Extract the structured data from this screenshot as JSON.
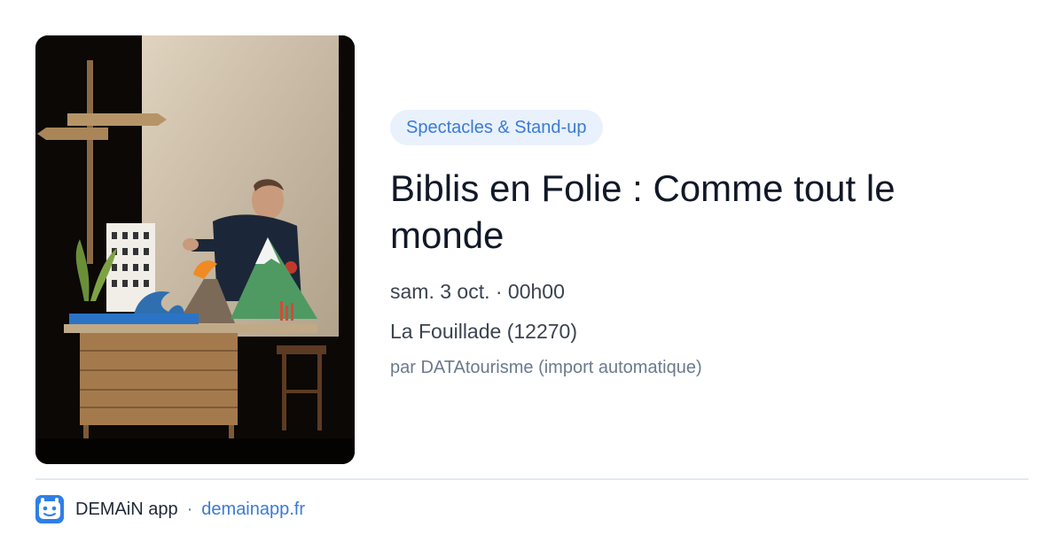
{
  "event": {
    "category": "Spectacles & Stand-up",
    "title": "Biblis en Folie : Comme tout le monde",
    "datetime": "sam. 3 oct. · 00h00",
    "location": "La Fouillade (12270)",
    "source": "par DATAtourisme (import automatique)"
  },
  "footer": {
    "app_name": "DEMAiN app",
    "separator": "·",
    "domain": "demainapp.fr",
    "icon": "demain-app-icon"
  },
  "colors": {
    "accent": "#3a7bd5",
    "chip_background": "#e9f1fc",
    "title": "#111827"
  }
}
